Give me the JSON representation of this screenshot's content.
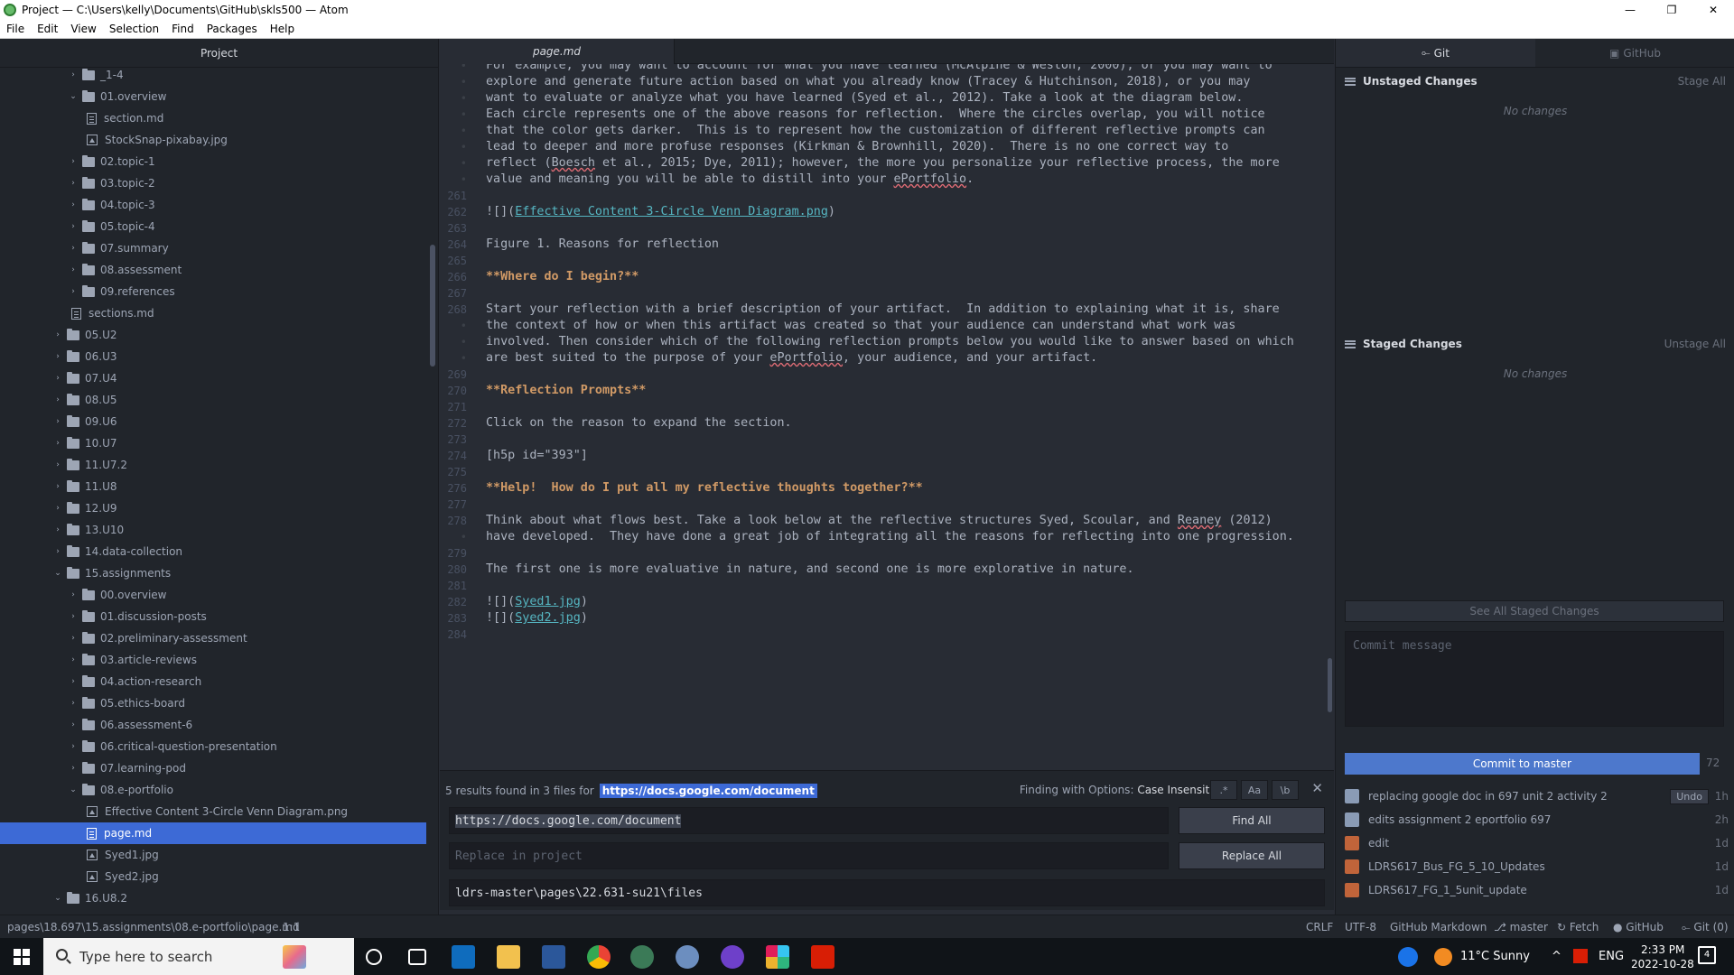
{
  "window": {
    "title": "Project — C:\\Users\\kelly\\Documents\\GitHub\\skls500 — Atom",
    "minimize": "—",
    "maximize": "❐",
    "close": "✕"
  },
  "menu": [
    "File",
    "Edit",
    "View",
    "Selection",
    "Find",
    "Packages",
    "Help"
  ],
  "tree": {
    "header": "Project",
    "items": [
      {
        "label": "_1-4",
        "kind": "folder",
        "level": 2,
        "open": false
      },
      {
        "label": "01.overview",
        "kind": "folder",
        "level": 2,
        "open": true
      },
      {
        "label": "section.md",
        "kind": "file",
        "level": 3
      },
      {
        "label": "StockSnap-pixabay.jpg",
        "kind": "image",
        "level": 3
      },
      {
        "label": "02.topic-1",
        "kind": "folder",
        "level": 2,
        "open": false
      },
      {
        "label": "03.topic-2",
        "kind": "folder",
        "level": 2,
        "open": false
      },
      {
        "label": "04.topic-3",
        "kind": "folder",
        "level": 2,
        "open": false
      },
      {
        "label": "05.topic-4",
        "kind": "folder",
        "level": 2,
        "open": false
      },
      {
        "label": "07.summary",
        "kind": "folder",
        "level": 2,
        "open": false
      },
      {
        "label": "08.assessment",
        "kind": "folder",
        "level": 2,
        "open": false
      },
      {
        "label": "09.references",
        "kind": "folder",
        "level": 2,
        "open": false
      },
      {
        "label": "sections.md",
        "kind": "file",
        "level": 2
      },
      {
        "label": "05.U2",
        "kind": "folder",
        "level": 1,
        "open": false
      },
      {
        "label": "06.U3",
        "kind": "folder",
        "level": 1,
        "open": false
      },
      {
        "label": "07.U4",
        "kind": "folder",
        "level": 1,
        "open": false
      },
      {
        "label": "08.U5",
        "kind": "folder",
        "level": 1,
        "open": false
      },
      {
        "label": "09.U6",
        "kind": "folder",
        "level": 1,
        "open": false
      },
      {
        "label": "10.U7",
        "kind": "folder",
        "level": 1,
        "open": false
      },
      {
        "label": "11.U7.2",
        "kind": "folder",
        "level": 1,
        "open": false
      },
      {
        "label": "11.U8",
        "kind": "folder",
        "level": 1,
        "open": false
      },
      {
        "label": "12.U9",
        "kind": "folder",
        "level": 1,
        "open": false
      },
      {
        "label": "13.U10",
        "kind": "folder",
        "level": 1,
        "open": false
      },
      {
        "label": "14.data-collection",
        "kind": "folder",
        "level": 1,
        "open": false
      },
      {
        "label": "15.assignments",
        "kind": "folder",
        "level": 1,
        "open": true
      },
      {
        "label": "00.overview",
        "kind": "folder",
        "level": 2,
        "open": false
      },
      {
        "label": "01.discussion-posts",
        "kind": "folder",
        "level": 2,
        "open": false
      },
      {
        "label": "02.preliminary-assessment",
        "kind": "folder",
        "level": 2,
        "open": false
      },
      {
        "label": "03.article-reviews",
        "kind": "folder",
        "level": 2,
        "open": false
      },
      {
        "label": "04.action-research",
        "kind": "folder",
        "level": 2,
        "open": false
      },
      {
        "label": "05.ethics-board",
        "kind": "folder",
        "level": 2,
        "open": false
      },
      {
        "label": "06.assessment-6",
        "kind": "folder",
        "level": 2,
        "open": false
      },
      {
        "label": "06.critical-question-presentation",
        "kind": "folder",
        "level": 2,
        "open": false
      },
      {
        "label": "07.learning-pod",
        "kind": "folder",
        "level": 2,
        "open": false
      },
      {
        "label": "08.e-portfolio",
        "kind": "folder",
        "level": 2,
        "open": true
      },
      {
        "label": "Effective Content 3-Circle Venn Diagram.png",
        "kind": "image",
        "level": 3
      },
      {
        "label": "page.md",
        "kind": "file",
        "level": 3,
        "selected": true
      },
      {
        "label": "Syed1.jpg",
        "kind": "image",
        "level": 3
      },
      {
        "label": "Syed2.jpg",
        "kind": "image",
        "level": 3
      },
      {
        "label": "16.U8.2",
        "kind": "folder",
        "level": 1,
        "open": true
      }
    ]
  },
  "editor": {
    "tab": "page.md",
    "lines": [
      {
        "num": "",
        "text": "For example, you may want to account for what you have learned (McAlpine & Weston, 2000), or you may want to",
        "style": "plain"
      },
      {
        "num": "",
        "text": "explore and generate future action based on what you already know (Tracey & Hutchinson, 2018), or you may",
        "style": "plain"
      },
      {
        "num": "",
        "text": "want to evaluate or analyze what you have learned (Syed et al., 2012). Take a look at the diagram below.",
        "style": "plain"
      },
      {
        "num": "",
        "text": "Each circle represents one of the above reasons for reflection.  Where the circles overlap, you will notice",
        "style": "plain"
      },
      {
        "num": "",
        "text": "that the color gets darker.  This is to represent how the customization of different reflective prompts can",
        "style": "plain"
      },
      {
        "num": "",
        "text": "lead to deeper and more profuse responses (Kirkman & Brownhill, 2020).  There is no one correct way to",
        "style": "plain"
      },
      {
        "num": "",
        "pre": "reflect (",
        "spell": "Boesch",
        "post": " et al., 2015; Dye, 2011); however, the more you personalize your reflective process, the more",
        "style": "spell"
      },
      {
        "num": "",
        "pre": "value and meaning you will be able to distill into your ",
        "spell": "ePortfolio",
        "post": ".",
        "style": "spell"
      },
      {
        "num": "261",
        "text": "",
        "style": "plain"
      },
      {
        "num": "262",
        "pre": "![](",
        "link": "Effective Content 3-Circle Venn Diagram.png",
        "post": ")",
        "style": "link"
      },
      {
        "num": "263",
        "text": "",
        "style": "plain"
      },
      {
        "num": "264",
        "text": "Figure 1. Reasons for reflection",
        "style": "plain"
      },
      {
        "num": "265",
        "text": "",
        "style": "plain"
      },
      {
        "num": "266",
        "text": "**Where do I begin?**",
        "style": "bold"
      },
      {
        "num": "267",
        "text": "",
        "style": "plain"
      },
      {
        "num": "268",
        "text": "Start your reflection with a brief description of your artifact.  In addition to explaining what it is, share",
        "style": "plain"
      },
      {
        "num": "",
        "text": "the context of how or when this artifact was created so that your audience can understand what work was",
        "style": "plain"
      },
      {
        "num": "",
        "text": "involved. Then consider which of the following reflection prompts below you would like to answer based on which",
        "style": "plain"
      },
      {
        "num": "",
        "pre": "are best suited to the purpose of your ",
        "spell": "ePortfolio",
        "post": ", your audience, and your artifact.",
        "style": "spell"
      },
      {
        "num": "269",
        "text": "",
        "style": "plain"
      },
      {
        "num": "270",
        "text": "**Reflection Prompts**",
        "style": "bold"
      },
      {
        "num": "271",
        "text": "",
        "style": "plain"
      },
      {
        "num": "272",
        "text": "Click on the reason to expand the section.",
        "style": "plain"
      },
      {
        "num": "273",
        "text": "",
        "style": "plain"
      },
      {
        "num": "274",
        "text": "[h5p id=\"393\"]",
        "style": "plain"
      },
      {
        "num": "275",
        "text": "",
        "style": "plain"
      },
      {
        "num": "276",
        "text": "**Help!  How do I put all my reflective thoughts together?**",
        "style": "bold"
      },
      {
        "num": "277",
        "text": "",
        "style": "plain"
      },
      {
        "num": "278",
        "pre": "Think about what flows best. Take a look below at the reflective structures Syed, Scoular, and ",
        "spell": "Reaney",
        "post": " (2012)",
        "style": "spell"
      },
      {
        "num": "",
        "text": "have developed.  They have done a great job of integrating all the reasons for reflecting into one progression.",
        "style": "plain"
      },
      {
        "num": "279",
        "text": "",
        "style": "plain"
      },
      {
        "num": "280",
        "text": "The first one is more evaluative in nature, and second one is more explorative in nature.",
        "style": "plain"
      },
      {
        "num": "281",
        "text": "",
        "style": "plain"
      },
      {
        "num": "282",
        "pre": "![](",
        "link": "Syed1.jpg",
        "post": ")",
        "style": "link"
      },
      {
        "num": "283",
        "pre": "![](",
        "link": "Syed2.jpg",
        "post": ")",
        "style": "link"
      },
      {
        "num": "284",
        "text": "",
        "style": "plain"
      }
    ]
  },
  "find": {
    "status": "5 results found in 3 files for",
    "query_highlight": "https://docs.google.com/document",
    "options_label": "Finding with Options:",
    "options_value": "Case Insensitive",
    "opt_regex": ".*",
    "opt_case": "Aa",
    "opt_word": "\\b",
    "close": "✕",
    "find_value": "https://docs.google.com/document",
    "replace_placeholder": "Replace in project",
    "find_all": "Find All",
    "replace_all": "Replace All",
    "path_value": "ldrs-master\\pages\\22.631-su21\\files"
  },
  "git": {
    "tab_git": "Git",
    "tab_github": "GitHub",
    "unstaged_title": "Unstaged Changes",
    "stage_all": "Stage All",
    "unstaged_empty": "No changes",
    "staged_title": "Staged Changes",
    "unstage_all": "Unstage All",
    "staged_empty": "No changes",
    "see_all": "See All Staged Changes",
    "commit_placeholder": "Commit message",
    "commit_button": "Commit to master",
    "char_count": "72",
    "undo": "Undo",
    "commits": [
      {
        "msg": "replacing google doc in 697 unit 2 activity 2",
        "time": "1h",
        "color": "#8a9bb5"
      },
      {
        "msg": "edits assignment 2 eportfolio 697",
        "time": "2h",
        "color": "#8a9bb5"
      },
      {
        "msg": "edit",
        "time": "1d",
        "color": "#c0643a"
      },
      {
        "msg": "LDRS617_Bus_FG_5_10_Updates",
        "time": "1d",
        "color": "#c0643a"
      },
      {
        "msg": "LDRS617_FG_1_5unit_update",
        "time": "1d",
        "color": "#c0643a"
      }
    ]
  },
  "status": {
    "path": "pages\\18.697\\15.assignments\\08.e-portfolio\\page.md",
    "cursor": "1:1",
    "eol": "CRLF",
    "encoding": "UTF-8",
    "grammar": "GitHub Markdown",
    "branch": "master",
    "fetch": "Fetch",
    "github": "GitHub",
    "git": "Git (0)"
  },
  "taskbar": {
    "search_placeholder": "Type here to search",
    "weather": "11°C  Sunny",
    "lang": "ENG",
    "time": "2:33 PM",
    "date": "2022-10-28",
    "notif_count": "4"
  }
}
